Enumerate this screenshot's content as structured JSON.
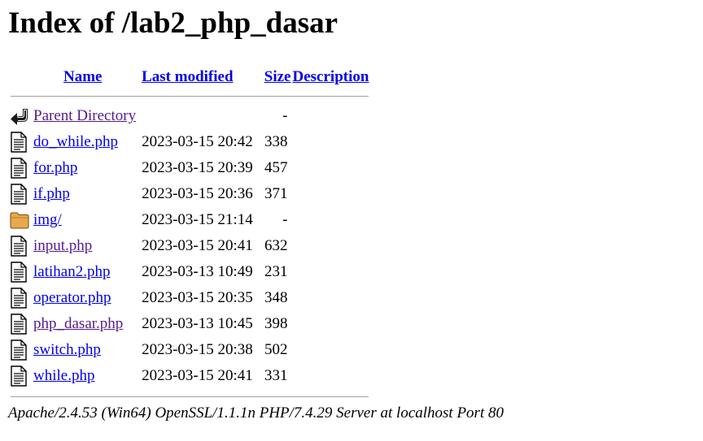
{
  "page": {
    "title": "Index of /lab2_php_dasar"
  },
  "columns": {
    "name": "Name",
    "last_modified": "Last modified",
    "size": "Size",
    "description": "Description"
  },
  "parent": {
    "label": "Parent Directory",
    "size": "-",
    "icon": "back-icon"
  },
  "entries": [
    {
      "name": "do_while.php",
      "modified": "2023-03-15 20:42",
      "size": "338",
      "icon": "file-icon",
      "visited": false
    },
    {
      "name": "for.php",
      "modified": "2023-03-15 20:39",
      "size": "457",
      "icon": "file-icon",
      "visited": false
    },
    {
      "name": "if.php",
      "modified": "2023-03-15 20:36",
      "size": "371",
      "icon": "file-icon",
      "visited": false
    },
    {
      "name": "img/",
      "modified": "2023-03-15 21:14",
      "size": "-",
      "icon": "folder-icon",
      "visited": false
    },
    {
      "name": "input.php",
      "modified": "2023-03-15 20:41",
      "size": "632",
      "icon": "file-icon",
      "visited": true
    },
    {
      "name": "latihan2.php",
      "modified": "2023-03-13 10:49",
      "size": "231",
      "icon": "file-icon",
      "visited": false
    },
    {
      "name": "operator.php",
      "modified": "2023-03-15 20:35",
      "size": "348",
      "icon": "file-icon",
      "visited": false
    },
    {
      "name": "php_dasar.php",
      "modified": "2023-03-13 10:45",
      "size": "398",
      "icon": "file-icon",
      "visited": true
    },
    {
      "name": "switch.php",
      "modified": "2023-03-15 20:38",
      "size": "502",
      "icon": "file-icon",
      "visited": false
    },
    {
      "name": "while.php",
      "modified": "2023-03-15 20:41",
      "size": "331",
      "icon": "file-icon",
      "visited": false
    }
  ],
  "footer": {
    "server": "Apache/2.4.53 (Win64) OpenSSL/1.1.1n PHP/7.4.29 Server at localhost Port 80"
  },
  "colors": {
    "link": "#0000ee",
    "visited": "#551a8b",
    "folder": "#e8a94c"
  }
}
